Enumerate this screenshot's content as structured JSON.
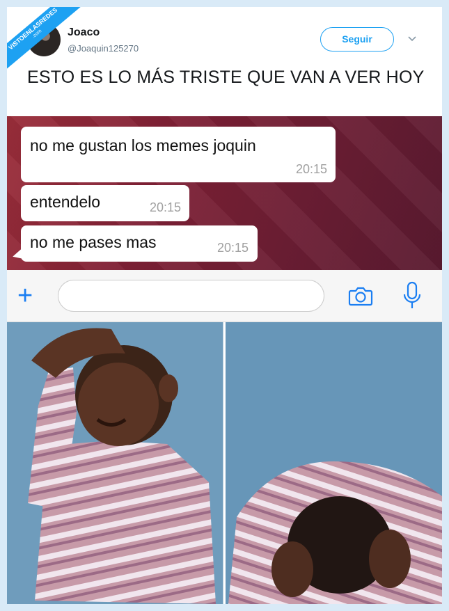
{
  "watermark": {
    "line1": "VISTOENLASREDES",
    "line2": ".com"
  },
  "tweet": {
    "author_name": "Joaco",
    "author_handle": "@Joaquin125270",
    "follow_label": "Seguir",
    "text": "ESTO ES LO MÁS TRISTE QUE VAN A VER HOY"
  },
  "chat": {
    "messages": [
      {
        "text": "no me gustan los memes joquin",
        "time": "20:15"
      },
      {
        "text": "entendelo",
        "time": "20:15"
      },
      {
        "text": "no me pases mas",
        "time": "20:15"
      }
    ],
    "input_placeholder": ""
  },
  "colors": {
    "accent": "#1da1f2",
    "chat_accent": "#1a7ef2"
  },
  "icons": [
    "chevron-down-icon",
    "plus-icon",
    "camera-icon",
    "microphone-icon"
  ]
}
